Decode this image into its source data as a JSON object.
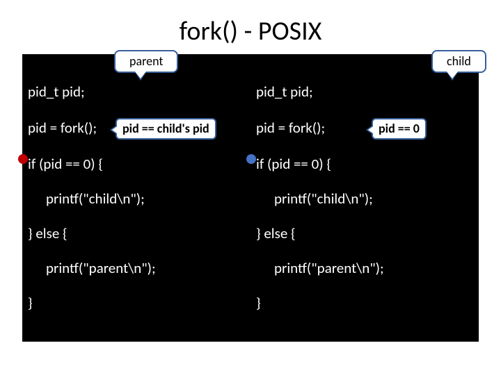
{
  "title": "fork() - POSIX",
  "labels": {
    "parent": "parent",
    "child": "child"
  },
  "callouts": {
    "parent_pid": "pid == child's pid",
    "child_pid": "pid == 0"
  },
  "code": {
    "decl": "pid_t  pid;",
    "fork": "pid = fork();",
    "if": "if (pid == 0) {",
    "print_child": "printf(\"child\\n\");",
    "else": "}    else    {",
    "print_parent": "printf(\"parent\\n\");",
    "close": "}"
  }
}
